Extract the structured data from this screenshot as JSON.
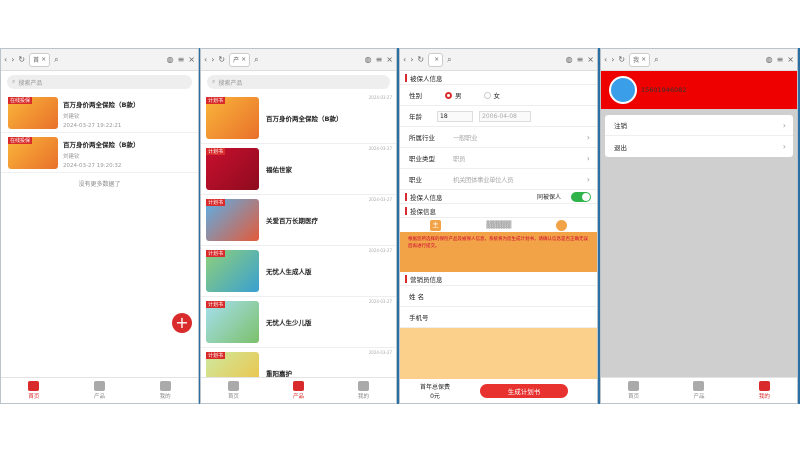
{
  "browser": {
    "tab1": "首",
    "tab2": "产",
    "tab3": "",
    "tab4": "我"
  },
  "nav": [
    "首页",
    "产品",
    "我的"
  ],
  "panel1": {
    "search": "搜索产品",
    "items": [
      {
        "tag": "在线投保",
        "title": "百万身价两全保险（B款）",
        "sub": "刘建钦",
        "time": "2024-03-27 19:22:21"
      },
      {
        "tag": "在线投保",
        "title": "百万身价两全保险（B款）",
        "sub": "刘建钦",
        "time": "2024-03-27 19:20:32"
      }
    ],
    "nomore": "没有更多数据了"
  },
  "panel2": {
    "search": "搜索产品",
    "items": [
      {
        "tag": "计划书",
        "title": "百万身价两全保险（B款）"
      },
      {
        "tag": "计划书",
        "title": "福佑世家"
      },
      {
        "tag": "计划书",
        "title": "关爱百万长期医疗"
      },
      {
        "tag": "计划书",
        "title": "无忧人生成人版"
      },
      {
        "tag": "计划书",
        "title": "无忧人生少儿版"
      },
      {
        "tag": "计划书",
        "title": "重阳嘉护"
      }
    ],
    "date": "2024-03-27"
  },
  "panel3": {
    "sec1": "被保人信息",
    "gender": "性别",
    "male": "男",
    "female": "女",
    "age": "年龄",
    "age_val": "18",
    "dob": "2006-04-08",
    "industry": "所属行业",
    "industry_val": "一般职业",
    "jobtype": "职业类型",
    "jobtype_val": "职员",
    "job": "职业",
    "job_val": "机关团体事业单位人员",
    "sec2": "投保人信息",
    "same": "同被保人",
    "sec3": "投保信息",
    "main": "主",
    "notice": "根据您所选择的保险产品及被保人信息，系统将为您生成计划书，请确认信息是否正确无误后再进行提交。",
    "sec4": "营销员信息",
    "name": "姓 名",
    "phone": "手机号",
    "fee_label": "首年总保费",
    "fee": "0元",
    "gen": "生成计划书"
  },
  "panel4": {
    "phone": "15601946082",
    "menu": [
      "注销",
      "退出"
    ]
  }
}
